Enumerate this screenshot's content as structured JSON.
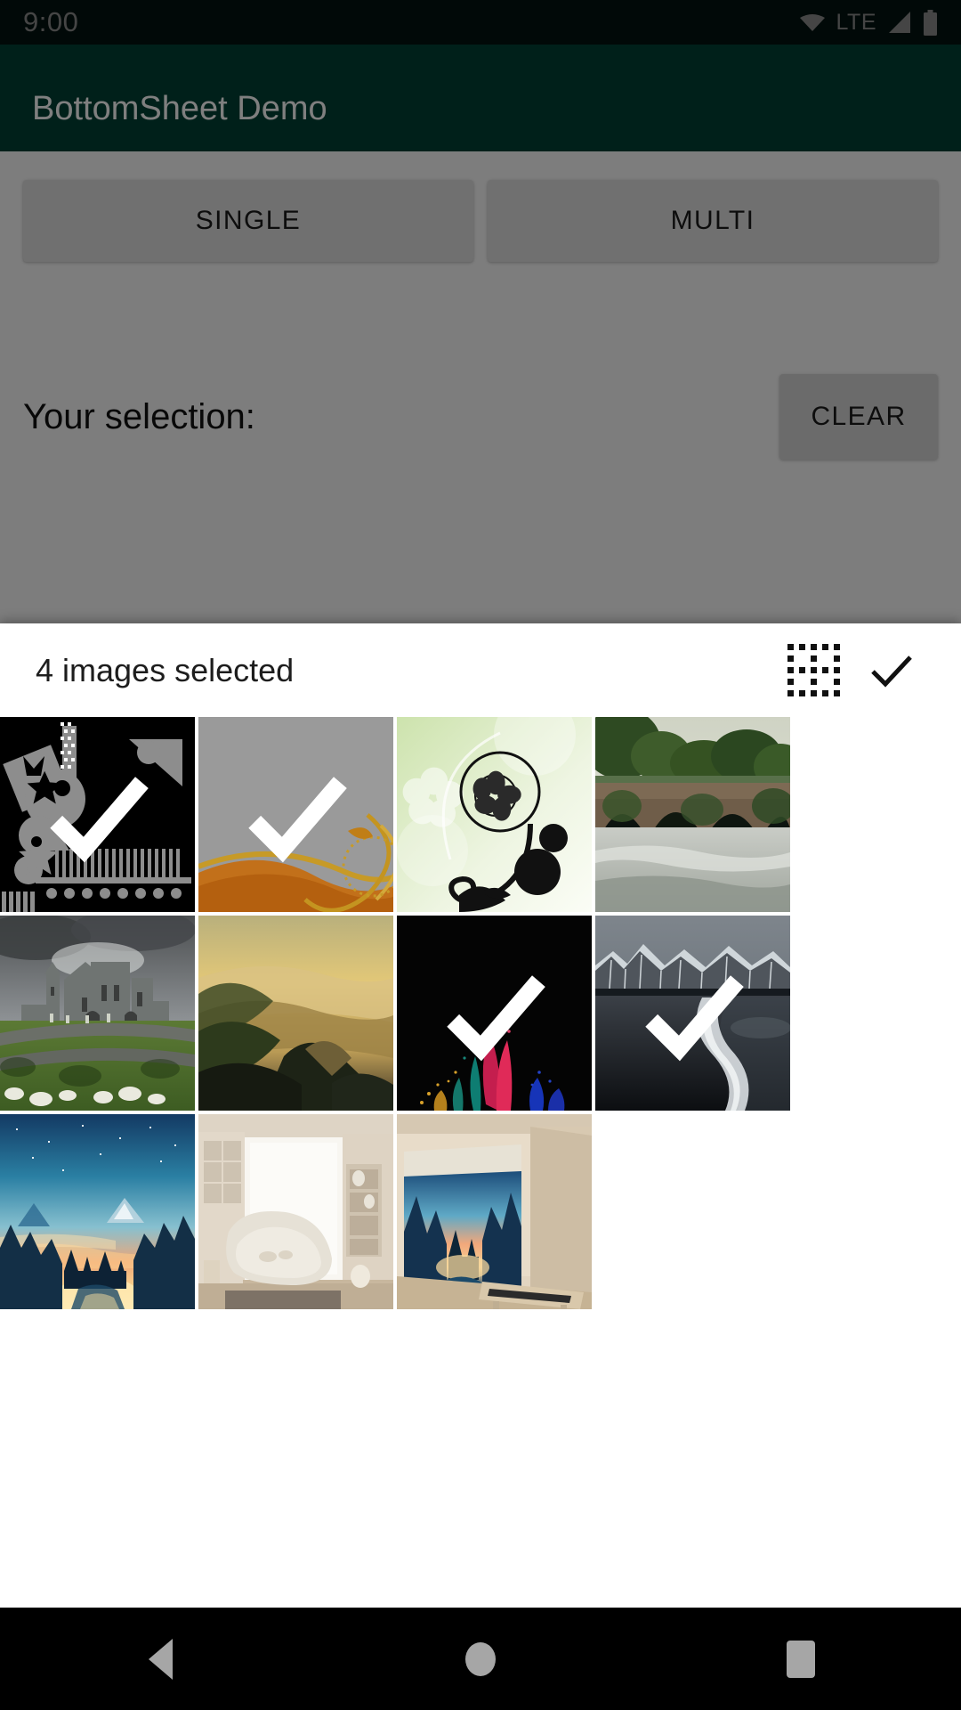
{
  "status_bar": {
    "clock": "9:00",
    "network_label": "LTE",
    "icons": [
      "wifi-icon",
      "signal-icon",
      "battery-icon"
    ],
    "background": "#06251e"
  },
  "app_bar": {
    "title": "BottomSheet Demo",
    "background": "#014034"
  },
  "main": {
    "buttons": [
      {
        "label": "SINGLE",
        "name": "single-button"
      },
      {
        "label": "MULTI",
        "name": "multi-button"
      }
    ],
    "selection_label": "Your selection:",
    "selection_value": "",
    "clear_label": "CLEAR"
  },
  "scrim": {
    "color": "#000000",
    "opacity": "0.50"
  },
  "sheet": {
    "title": "4 images selected",
    "selected_count": 4,
    "total_images": 11,
    "grid_icon": "border-select-icon",
    "confirm_icon": "check-icon",
    "columns": 4,
    "check_color": "#ffffff",
    "images": [
      {
        "name": "abstract-geometric-shapes",
        "selected": true,
        "alt": "black abstract geometric shapes"
      },
      {
        "name": "gold-swirl-on-grey",
        "selected": true,
        "alt": "grey background with gold swirl"
      },
      {
        "name": "green-floral-vector",
        "selected": false,
        "alt": "green floral vector flourish"
      },
      {
        "name": "stone-bridge-over-river",
        "selected": false,
        "alt": "stone arch bridge over river"
      },
      {
        "name": "rock-of-cashel-castle",
        "selected": false,
        "alt": "grey castle ruins on green field"
      },
      {
        "name": "golden-mountain-sunrise",
        "selected": false,
        "alt": "golden sunlit mountain ridge"
      },
      {
        "name": "colour-powder-explosion",
        "selected": true,
        "alt": "coloured powder burst on black"
      },
      {
        "name": "black-sand-beach-mountains",
        "selected": true,
        "alt": "dark beach with snowy mountains"
      },
      {
        "name": "pixel-sunset-forest",
        "selected": false,
        "alt": "pixel art sunset over pine forest"
      },
      {
        "name": "bright-living-room",
        "selected": false,
        "alt": "bright minimal living room render"
      },
      {
        "name": "room-with-framed-art",
        "selected": false,
        "alt": "room with framed sunset artwork"
      }
    ]
  },
  "nav_bar": {
    "background": "#000000",
    "buttons": [
      {
        "name": "nav-back-button",
        "icon": "back-triangle-icon"
      },
      {
        "name": "nav-home-button",
        "icon": "home-circle-icon"
      },
      {
        "name": "nav-recents-button",
        "icon": "recents-square-icon"
      }
    ]
  }
}
